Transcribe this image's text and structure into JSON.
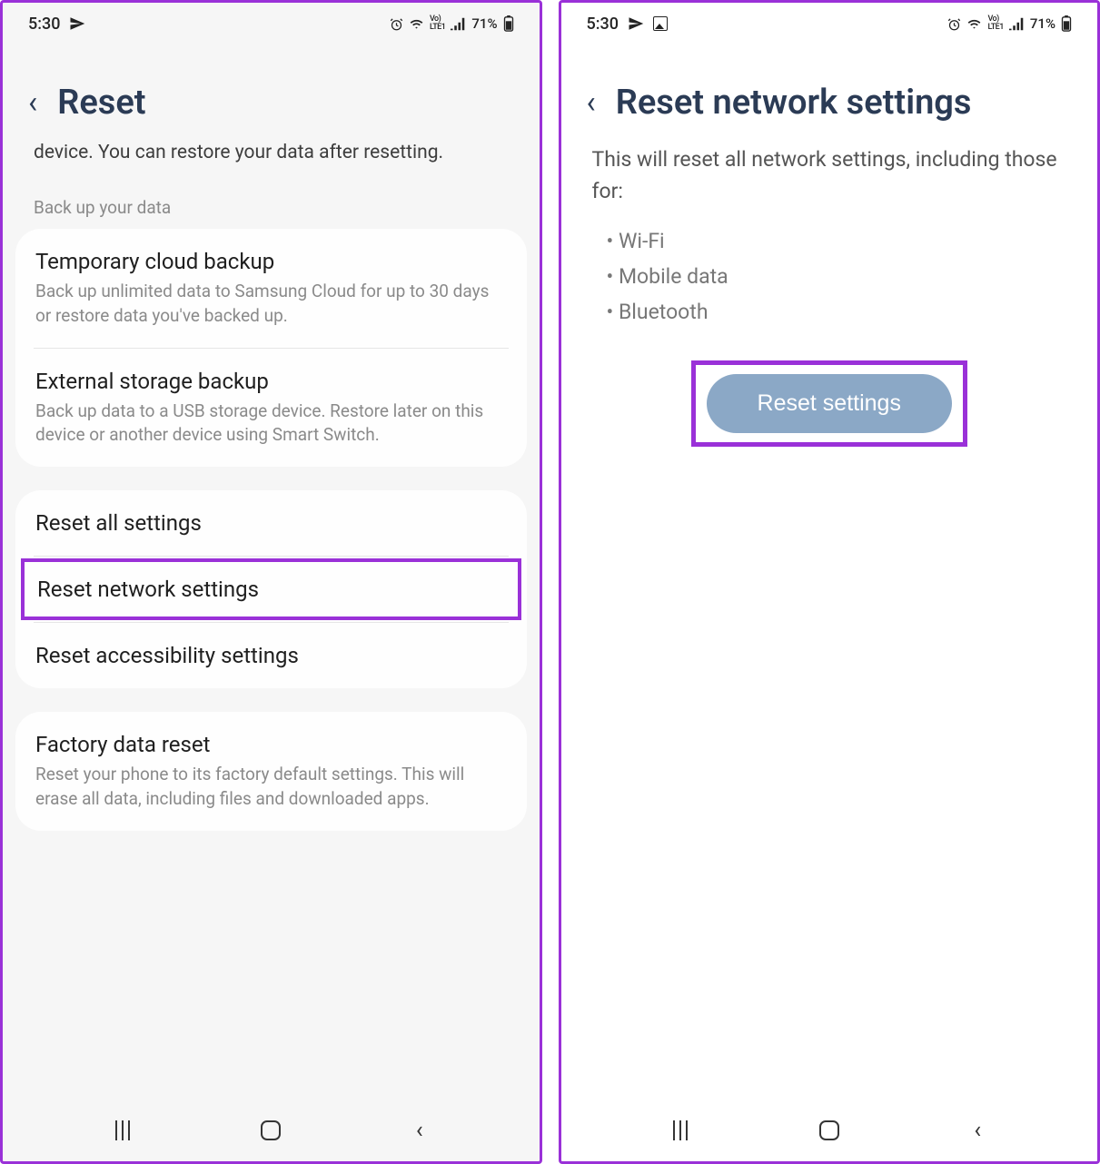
{
  "statusBar": {
    "time": "5:30",
    "battery": "71%"
  },
  "screen1": {
    "title": "Reset",
    "intro": "device. You can restore your data after resetting.",
    "sectionLabel": "Back up your data",
    "backup": {
      "cloud": {
        "title": "Temporary cloud backup",
        "desc": "Back up unlimited data to Samsung Cloud for up to 30 days or restore data you've backed up."
      },
      "external": {
        "title": "External storage backup",
        "desc": "Back up data to a USB storage device. Restore later on this device or another device using Smart Switch."
      }
    },
    "resets": {
      "all": "Reset all settings",
      "network": "Reset network settings",
      "accessibility": "Reset accessibility settings"
    },
    "factory": {
      "title": "Factory data reset",
      "desc": "Reset your phone to its factory default settings. This will erase all data, including files and downloaded apps."
    }
  },
  "screen2": {
    "title": "Reset network settings",
    "desc": "This will reset all network settings, including those for:",
    "bullets": {
      "wifi": "Wi-Fi",
      "mobile": "Mobile data",
      "bluetooth": "Bluetooth"
    },
    "button": "Reset settings"
  }
}
